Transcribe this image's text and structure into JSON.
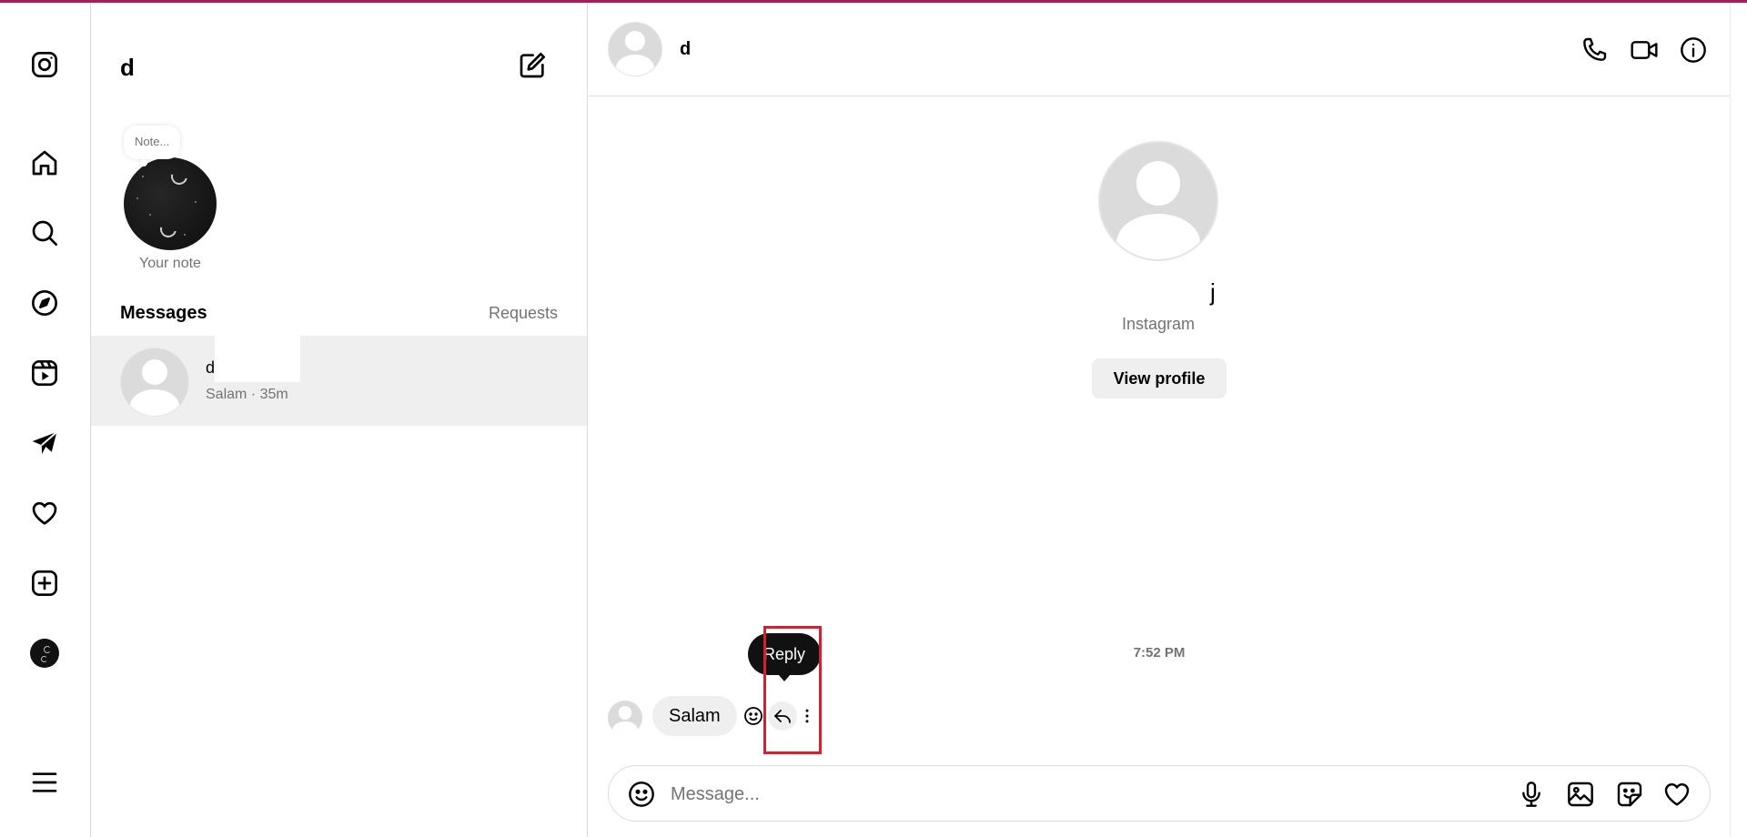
{
  "nav": {
    "items": [
      {
        "name": "instagram-logo-icon"
      },
      {
        "name": "home-icon"
      },
      {
        "name": "search-icon"
      },
      {
        "name": "explore-compass-icon"
      },
      {
        "name": "reels-icon"
      },
      {
        "name": "messages-send-icon"
      },
      {
        "name": "notifications-heart-icon"
      },
      {
        "name": "create-plus-icon"
      },
      {
        "name": "profile-avatar"
      },
      {
        "name": "more-menu-icon"
      }
    ]
  },
  "inbox": {
    "username": "d",
    "note_bubble": "Note...",
    "note_label": "Your note",
    "messages_heading": "Messages",
    "requests_label": "Requests",
    "threads": [
      {
        "name": "d",
        "preview": "Salam · 35m"
      }
    ]
  },
  "chat": {
    "header_name": "d",
    "profile_name": "j",
    "profile_subtitle": "Instagram",
    "view_profile_label": "View profile",
    "timestamp": "7:52 PM",
    "messages": [
      {
        "text": "Salam"
      }
    ],
    "tooltip": "Reply",
    "composer_placeholder": "Message..."
  },
  "colors": {
    "accent_bar": "#a61c5c",
    "highlight_box": "#d6202d",
    "selected_thread_bg": "#efefef",
    "bubble_bg": "#efefef",
    "muted_text": "#737373"
  }
}
